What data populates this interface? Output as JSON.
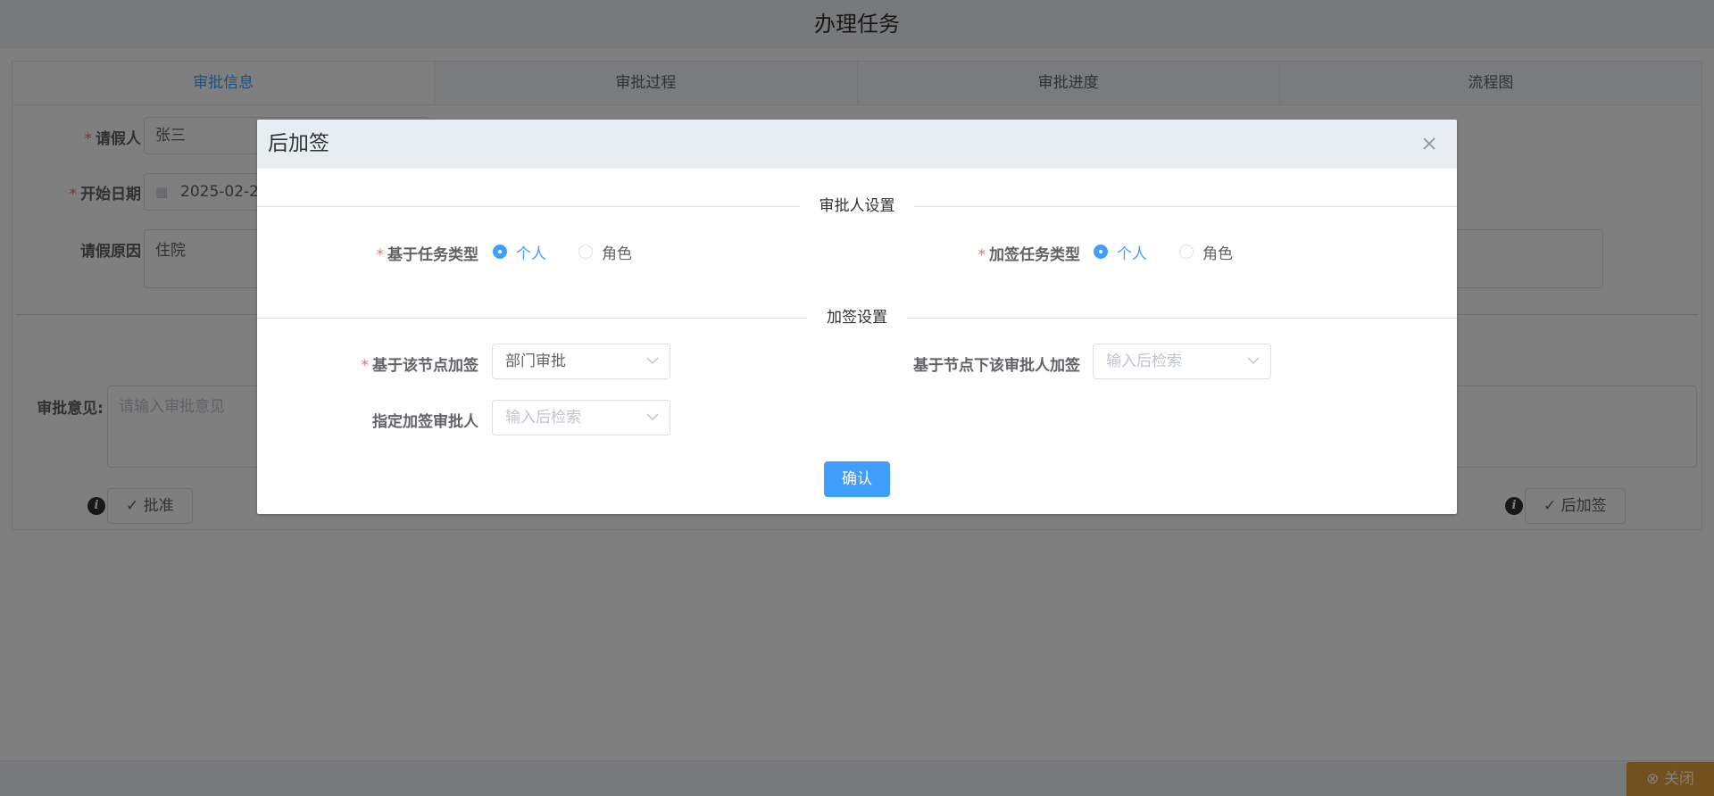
{
  "page": {
    "title": "办理任务"
  },
  "tabs": [
    {
      "label": "审批信息"
    },
    {
      "label": "审批过程"
    },
    {
      "label": "审批进度"
    },
    {
      "label": "流程图"
    }
  ],
  "form": {
    "applicant_label": "请假人",
    "applicant_value": "张三",
    "start_date_label": "开始日期",
    "start_date_value": "2025-02-27",
    "reason_label": "请假原因",
    "reason_value": "住院",
    "opinion_label": "审批意见:",
    "opinion_placeholder": "请输入审批意见",
    "approve_button": "批准",
    "add_sign_after_button": "后加签"
  },
  "footer": {
    "close_label": "关闭"
  },
  "dialog": {
    "title": "后加签",
    "section_approver": "审批人设置",
    "section_add_sign": "加签设置",
    "based_task_type_label": "基于任务类型",
    "based_task_type_options": [
      "个人",
      "角色"
    ],
    "based_task_type_selected": "个人",
    "add_sign_task_type_label": "加签任务类型",
    "add_sign_task_type_options": [
      "个人",
      "角色"
    ],
    "add_sign_task_type_selected": "个人",
    "based_node_label": "基于该节点加签",
    "based_node_value": "部门审批",
    "based_node_approver_label": "基于节点下该审批人加签",
    "based_node_approver_placeholder": "输入后检索",
    "assign_approver_label": "指定加签审批人",
    "assign_approver_placeholder": "输入后检索",
    "confirm_label": "确认"
  },
  "colors": {
    "primary": "#409eff",
    "required": "#f56c6c",
    "warning": "#e6a23c",
    "dialog_header_bg": "#e8edf4"
  }
}
